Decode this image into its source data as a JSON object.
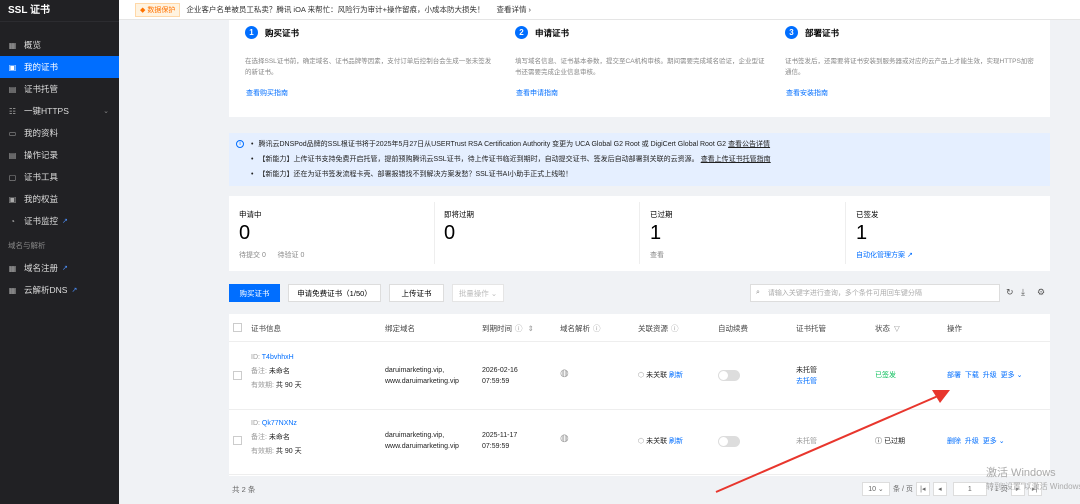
{
  "sidebar": {
    "title": "SSL 证书",
    "items": [
      {
        "label": "概览"
      },
      {
        "label": "我的证书"
      },
      {
        "label": "证书托管"
      },
      {
        "label": "一键HTTPS"
      },
      {
        "label": "我的资料"
      },
      {
        "label": "操作记录"
      },
      {
        "label": "证书工具"
      },
      {
        "label": "我的权益"
      },
      {
        "label": "证书监控"
      }
    ],
    "section": "域名与解析",
    "section_items": [
      {
        "label": "域名注册"
      },
      {
        "label": "云解析DNS"
      }
    ]
  },
  "topbar": {
    "badge": "数据保护",
    "text": "企业客户名单被员工私卖？腾讯 iOA 来帮忙：风险行为审计+操作留痕，小成本防大损失！",
    "link": "查看详情 ›"
  },
  "steps": [
    {
      "num": "1",
      "title": "购买证书",
      "desc": "在选择SSL证书前，确定域名、证书品牌等因素，支付订单后控制台会生成一张未签发的新证书。",
      "link": "查看购买指南"
    },
    {
      "num": "2",
      "title": "申请证书",
      "desc": "填写域名信息、证书基本参数，提交至CA机构审核。期间需要完成域名验证，企业型证书还需要完成企业信息审核。",
      "link": "查看申请指南"
    },
    {
      "num": "3",
      "title": "部署证书",
      "desc": "证书签发后，还需要将证书安装到服务器或对应的云产品上才能生效，实现HTTPS加密通信。",
      "link": "查看安装指南"
    }
  ],
  "notice": {
    "line1": "腾讯云DNSPod品牌的SSL根证书将于2025年5月27日从USERTrust RSA Certification Authority 变更为 UCA Global G2 Root 或 DigiCert Global Root G2",
    "line1_link": "查看公告详情",
    "line2": "【新能力】上传证书支持免费开启托管，提前预购腾讯云SSL证书，待上传证书临近到期时，自动提交证书、签发后自动部署到关联的云资源。",
    "line2_link": "查看上传证书托管指南",
    "line3": "【新能力】还在为证书签发流程卡壳、部署报错找不到解决方案发愁？SSL证书AI小助手正式上线啦！"
  },
  "stats": [
    {
      "label": "申请中",
      "value": "0",
      "sub1": "待提交 0",
      "sub2": "待验证 0"
    },
    {
      "label": "即将过期",
      "value": "0",
      "sub1": ""
    },
    {
      "label": "已过期",
      "value": "1",
      "sub1": "查看"
    },
    {
      "label": "已签发",
      "value": "1",
      "sub1": "自动化管理方案"
    }
  ],
  "toolbar": {
    "buy": "购买证书",
    "apply": "申请免费证书（1/50）",
    "upload": "上传证书",
    "batch": "批量操作",
    "search_placeholder": "请输入关键字进行查询，多个条件可用回车键分隔"
  },
  "table": {
    "headers": [
      "证书信息",
      "绑定域名",
      "到期时间",
      "域名解析",
      "关联资源",
      "自动续费",
      "证书托管",
      "状态",
      "操作"
    ],
    "rows": [
      {
        "id_label": "ID:",
        "id": "T4bvhhxH",
        "note_label": "备注:",
        "note": "未命名",
        "valid_label": "有效期:",
        "valid": "共 90 天",
        "domain1": "daruimarketing.vip,",
        "domain2": "www.daruimarketing.vip",
        "date": "2026-02-16",
        "time": "07:59:59",
        "assoc": "未关联",
        "refresh": "刷新",
        "hosting1": "未托管",
        "hosting2": "去托管",
        "status": "已签发",
        "ops": [
          "部署",
          "下载",
          "升级",
          "更多"
        ]
      },
      {
        "id_label": "ID:",
        "id": "Qk77NXNz",
        "note_label": "备注:",
        "note": "未命名",
        "valid_label": "有效期:",
        "valid": "共 90 天",
        "domain1": "daruimarketing.vip,",
        "domain2": "www.daruimarketing.vip",
        "date": "2025-11-17",
        "time": "07:59:59",
        "assoc": "未关联",
        "refresh": "刷新",
        "hosting1": "未托管",
        "hosting2": "",
        "status": "已过期",
        "ops": [
          "删除",
          "升级",
          "更多"
        ]
      }
    ]
  },
  "footer": {
    "total": "共 2 条",
    "page_size": "10",
    "per_page": "条 / 页",
    "page": "1",
    "pages": "/ 1 页"
  },
  "watermark": {
    "line1": "激活 Windows",
    "line2": "转到\"设置\"以激活 Windows。"
  },
  "colors": {
    "accent": "#006eff",
    "success": "#0abf5b",
    "annotation_arrow": "#e8362d"
  }
}
